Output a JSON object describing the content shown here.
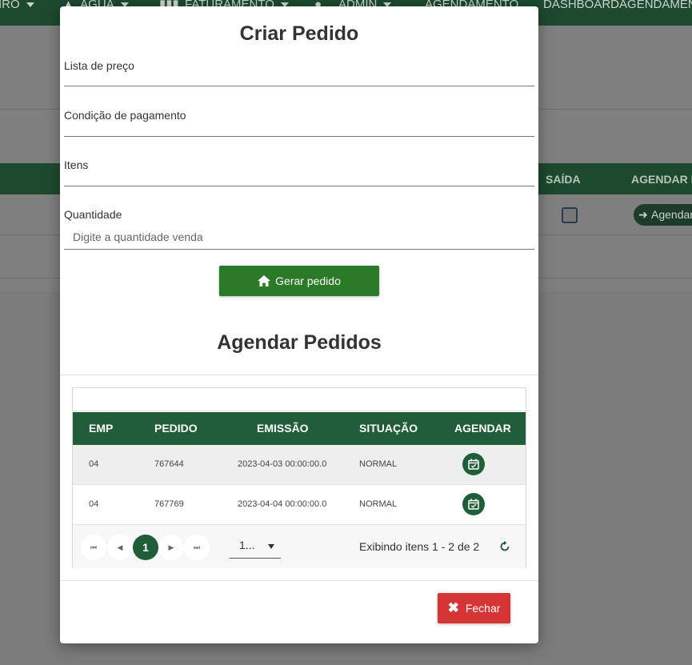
{
  "background": {
    "nav_items": [
      {
        "label": "IRO"
      },
      {
        "label": "ÁGUA"
      },
      {
        "label": "FATURAMENTO"
      },
      {
        "label": "ADMIN"
      },
      {
        "label": "AGENDAMENTO"
      },
      {
        "label": "DASHBOARDAGENDAMENTO"
      }
    ],
    "table_headers": {
      "saida": "SAÍDA",
      "agendar": "AGENDAR P"
    },
    "agendar_button": "Agendar"
  },
  "modal": {
    "title": "Criar Pedido",
    "fields": {
      "lista_preco": "Lista de preço",
      "condicao_pagamento": "Condição de pagamento",
      "itens": "Itens",
      "quantidade": "Quantidade",
      "quantidade_placeholder": "Digite a quantidade venda"
    },
    "gerar_button": "Gerar pedido",
    "section_title": "Agendar Pedidos",
    "grid": {
      "headers": {
        "emp": "EMP",
        "pedido": "PEDIDO",
        "emissao": "EMISSÃO",
        "situacao": "SITUAÇÃO",
        "agendar": "AGENDAR"
      },
      "rows": [
        {
          "emp": "04",
          "pedido": "767644",
          "emissao": "2023-04-03 00:00:00.0",
          "situacao": "NORMAL"
        },
        {
          "emp": "04",
          "pedido": "767769",
          "emissao": "2023-04-04 00:00:00.0",
          "situacao": "NORMAL"
        }
      ],
      "pager": {
        "first": "⏮",
        "prev": "◀",
        "current_page": "1",
        "next": "▶",
        "last": "⏭",
        "page_size": "1...",
        "info": "Exibindo itens 1 - 2 de 2"
      }
    },
    "fechar_button": "Fechar"
  },
  "colors": {
    "brand_green": "#1f5e38",
    "gerar_green": "#2a7a28",
    "fechar_red": "#d63535"
  }
}
